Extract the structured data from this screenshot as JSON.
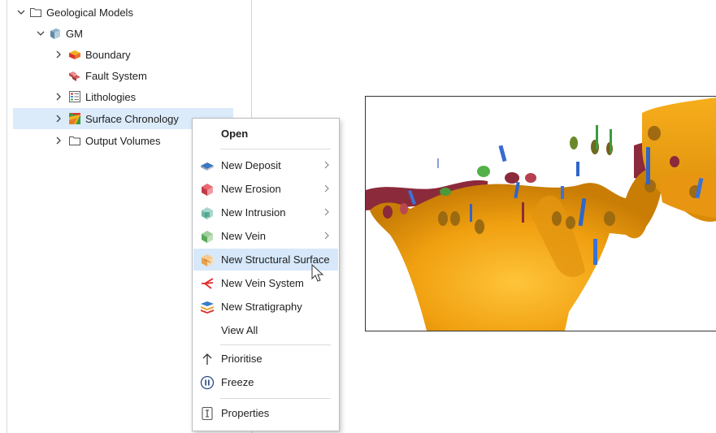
{
  "tree": {
    "items": [
      {
        "label": "Geological Models",
        "icon": "folder-icon",
        "expanded": true
      },
      {
        "label": "GM",
        "icon": "geological-model-icon",
        "expanded": true
      },
      {
        "label": "Boundary",
        "icon": "boundary-icon",
        "expanded": false
      },
      {
        "label": "Fault System",
        "icon": "fault-system-icon"
      },
      {
        "label": "Lithologies",
        "icon": "lithologies-icon",
        "expanded": false
      },
      {
        "label": "Surface Chronology",
        "icon": "surface-chronology-icon",
        "expanded": false,
        "selected": true
      },
      {
        "label": "Output Volumes",
        "icon": "folder-icon",
        "expanded": false
      }
    ]
  },
  "menu": {
    "open": "Open",
    "new_deposit": "New Deposit",
    "new_erosion": "New Erosion",
    "new_intrusion": "New Intrusion",
    "new_vein": "New Vein",
    "new_structural_surface": "New Structural Surface",
    "new_vein_system": "New Vein System",
    "new_stratigraphy": "New Stratigraphy",
    "view_all": "View All",
    "prioritise": "Prioritise",
    "freeze": "Freeze",
    "properties": "Properties",
    "highlighted_item": "New Structural Surface"
  },
  "colors": {
    "selection": "#dcebfa",
    "menu_highlight": "#d6e8fa",
    "surface_orange": "#f0a010",
    "surface_dark_red": "#8b2a3a"
  }
}
